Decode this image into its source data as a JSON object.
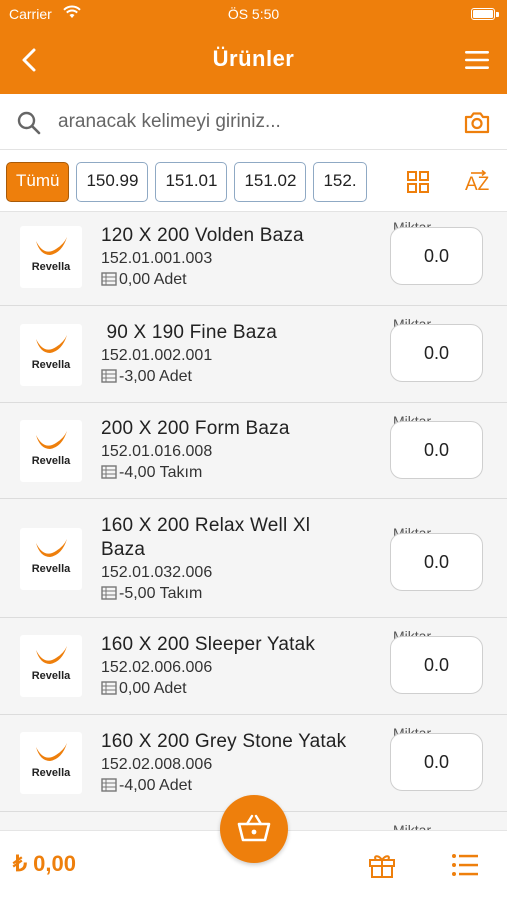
{
  "status_bar": {
    "carrier": "Carrier",
    "time": "ÖS 5:50"
  },
  "nav": {
    "title": "Ürünler"
  },
  "search": {
    "placeholder": "aranacak kelimeyi giriniz..."
  },
  "filters": {
    "chips": [
      "Tümü",
      "150.99",
      "151.01",
      "151.02",
      "152."
    ],
    "active": "Tümü",
    "sort_label": "AZ"
  },
  "product_brand": "Revella",
  "quantity_label": "Miktar",
  "products": [
    {
      "name": "120 X 200 Volden Baza",
      "code": "152.01.001.003",
      "stock": "0,00 Adet",
      "qty": "0.0"
    },
    {
      "name": " 90 X 190 Fine Baza",
      "code": "152.01.002.001",
      "stock": "-3,00 Adet",
      "qty": "0.0"
    },
    {
      "name": "200 X 200 Form Baza",
      "code": "152.01.016.008",
      "stock": "-4,00 Takım",
      "qty": "0.0"
    },
    {
      "name": "160 X 200 Relax Well Xl Baza",
      "code": "152.01.032.006",
      "stock": "-5,00 Takım",
      "qty": "0.0"
    },
    {
      "name": "160 X 200 Sleeper Yatak",
      "code": "152.02.006.006",
      "stock": "0,00 Adet",
      "qty": "0.0"
    },
    {
      "name": "160 X 200 Grey Stone Yatak",
      "code": "152.02.008.006",
      "stock": "-4,00 Adet",
      "qty": "0.0"
    }
  ],
  "bottom": {
    "total": "₺ 0,00"
  },
  "colors": {
    "accent": "#ee7f0c"
  }
}
